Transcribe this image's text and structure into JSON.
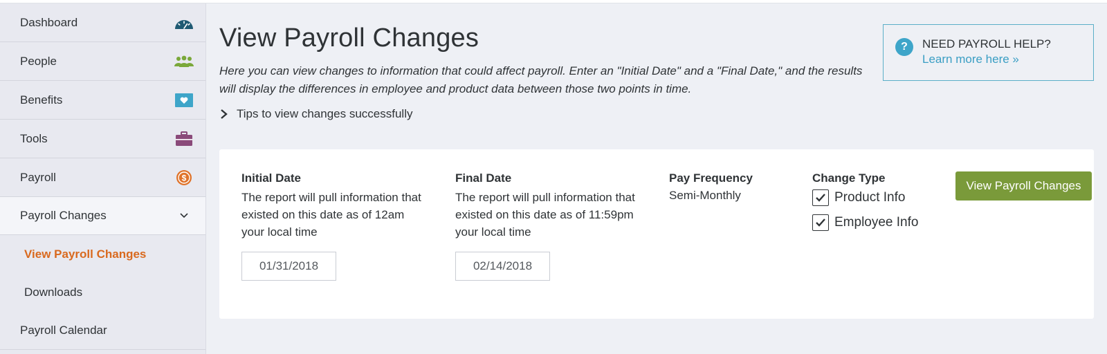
{
  "sidebar": {
    "items": [
      {
        "label": "Dashboard",
        "icon": "speedometer-icon",
        "color": "#1f5a73"
      },
      {
        "label": "People",
        "icon": "people-icon",
        "color": "#7aa83a"
      },
      {
        "label": "Benefits",
        "icon": "heart-card-icon",
        "color": "#3ea5c9"
      },
      {
        "label": "Tools",
        "icon": "briefcase-icon",
        "color": "#8a4a7a"
      },
      {
        "label": "Payroll",
        "icon": "dollar-coin-icon",
        "color": "#e0732a"
      }
    ],
    "expanded": {
      "label": "Payroll Changes"
    },
    "sub_items": [
      {
        "label": "View Payroll Changes",
        "active": true
      },
      {
        "label": "Downloads",
        "active": false
      }
    ],
    "after": {
      "label": "Payroll Calendar"
    }
  },
  "page": {
    "title": "View Payroll Changes",
    "description": "Here you can view changes to information that could affect payroll. Enter an \"Initial Date\" and a \"Final Date,\" and the results will display the differences in employee and product data between those two points in time.",
    "tips_label": "Tips to view changes successfully"
  },
  "help": {
    "title": "NEED PAYROLL HELP?",
    "link": "Learn more here »"
  },
  "form": {
    "initial": {
      "label": "Initial Date",
      "help": "The report will pull information that existed on this date as of 12am your local time",
      "value": "01/31/2018"
    },
    "final": {
      "label": "Final Date",
      "help": "The report will pull information that existed on this date as of 11:59pm your local time",
      "value": "02/14/2018"
    },
    "frequency": {
      "label": "Pay Frequency",
      "value": "Semi-Monthly"
    },
    "change_type": {
      "label": "Change Type",
      "options": [
        {
          "label": "Product Info",
          "checked": true
        },
        {
          "label": "Employee Info",
          "checked": true
        }
      ]
    },
    "submit_label": "View Payroll Changes"
  },
  "colors": {
    "accent_orange": "#d9691e",
    "button_green": "#7a9a3a",
    "link_blue": "#3a9ec4"
  }
}
